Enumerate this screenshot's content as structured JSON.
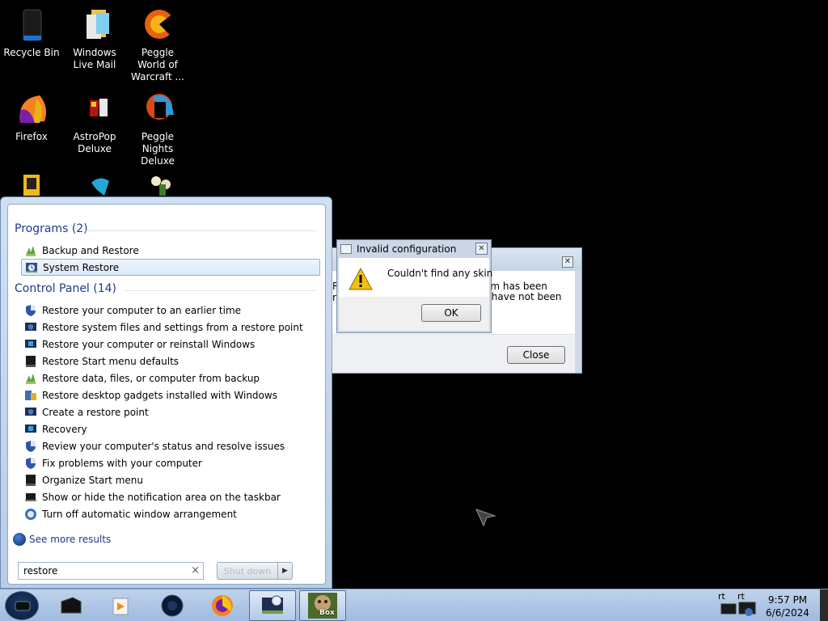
{
  "desktop": {
    "icons": [
      {
        "label": "Recycle Bin"
      },
      {
        "label": "Windows Live Mail"
      },
      {
        "label": "Peggle World of Warcraft ..."
      },
      {
        "label": "Firefox"
      },
      {
        "label": "AstroPop Deluxe"
      },
      {
        "label": "Peggle Nights Deluxe"
      }
    ]
  },
  "start_menu": {
    "programs_header": "Programs (2)",
    "programs": [
      {
        "label": "Backup and Restore",
        "icon": "backup-restore-icon"
      },
      {
        "label": "System Restore",
        "icon": "system-restore-icon",
        "selected": true
      }
    ],
    "control_panel_header": "Control Panel (14)",
    "control_panel": [
      {
        "label": "Restore your computer to an earlier time",
        "icon": "shield-icon"
      },
      {
        "label": "Restore system files and settings from a restore point",
        "icon": "monitor-shield-icon"
      },
      {
        "label": "Restore your computer or reinstall Windows",
        "icon": "monitor-flag-icon"
      },
      {
        "label": "Restore Start menu defaults",
        "icon": "taskbar-icon"
      },
      {
        "label": "Restore data, files, or computer from backup",
        "icon": "backup-restore-icon"
      },
      {
        "label": "Restore desktop gadgets installed with Windows",
        "icon": "gadgets-icon"
      },
      {
        "label": "Create a restore point",
        "icon": "monitor-shield-icon"
      },
      {
        "label": "Recovery",
        "icon": "monitor-flag-icon"
      },
      {
        "label": "Review your computer's status and resolve issues",
        "icon": "shield-icon"
      },
      {
        "label": "Fix problems with your computer",
        "icon": "shield-icon"
      },
      {
        "label": "Organize Start menu",
        "icon": "taskbar-icon"
      },
      {
        "label": "Show or hide the notification area on the taskbar",
        "icon": "laptop-icon"
      },
      {
        "label": "Turn off automatic window arrangement",
        "icon": "ease-of-access-icon"
      }
    ],
    "see_more": "See more results",
    "search_value": "restore",
    "search_clear": "×",
    "shutdown_label": "Shut down",
    "shutdown_arrow": "▶"
  },
  "back_dialog": {
    "close_x": "✕",
    "text_line1": "em has been",
    "text_line2": "ts have not been",
    "left_fragment1": "R",
    "left_fragment2": "r",
    "close_button": "Close"
  },
  "front_dialog": {
    "title": "Invalid configuration",
    "close_x": "✕",
    "message": "Couldn't find any skin",
    "ok_button": "OK",
    "icon": "warning-icon"
  },
  "taskbar": {
    "clock_time": "9:57 PM",
    "clock_date": "6/6/2024",
    "tray_labels": [
      "rt",
      "rt"
    ],
    "buttons": [
      {
        "name": "taskbar-app-1",
        "icon": "black-box-icon"
      },
      {
        "name": "taskbar-media",
        "icon": "media-player-icon"
      },
      {
        "name": "taskbar-app-3",
        "icon": "dark-globe-icon"
      },
      {
        "name": "taskbar-firefox",
        "icon": "firefox-icon"
      },
      {
        "name": "taskbar-system-restore",
        "icon": "system-restore-icon",
        "active": true
      },
      {
        "name": "taskbar-box",
        "icon": "box-game-icon",
        "label": "Box",
        "active": true
      }
    ]
  }
}
